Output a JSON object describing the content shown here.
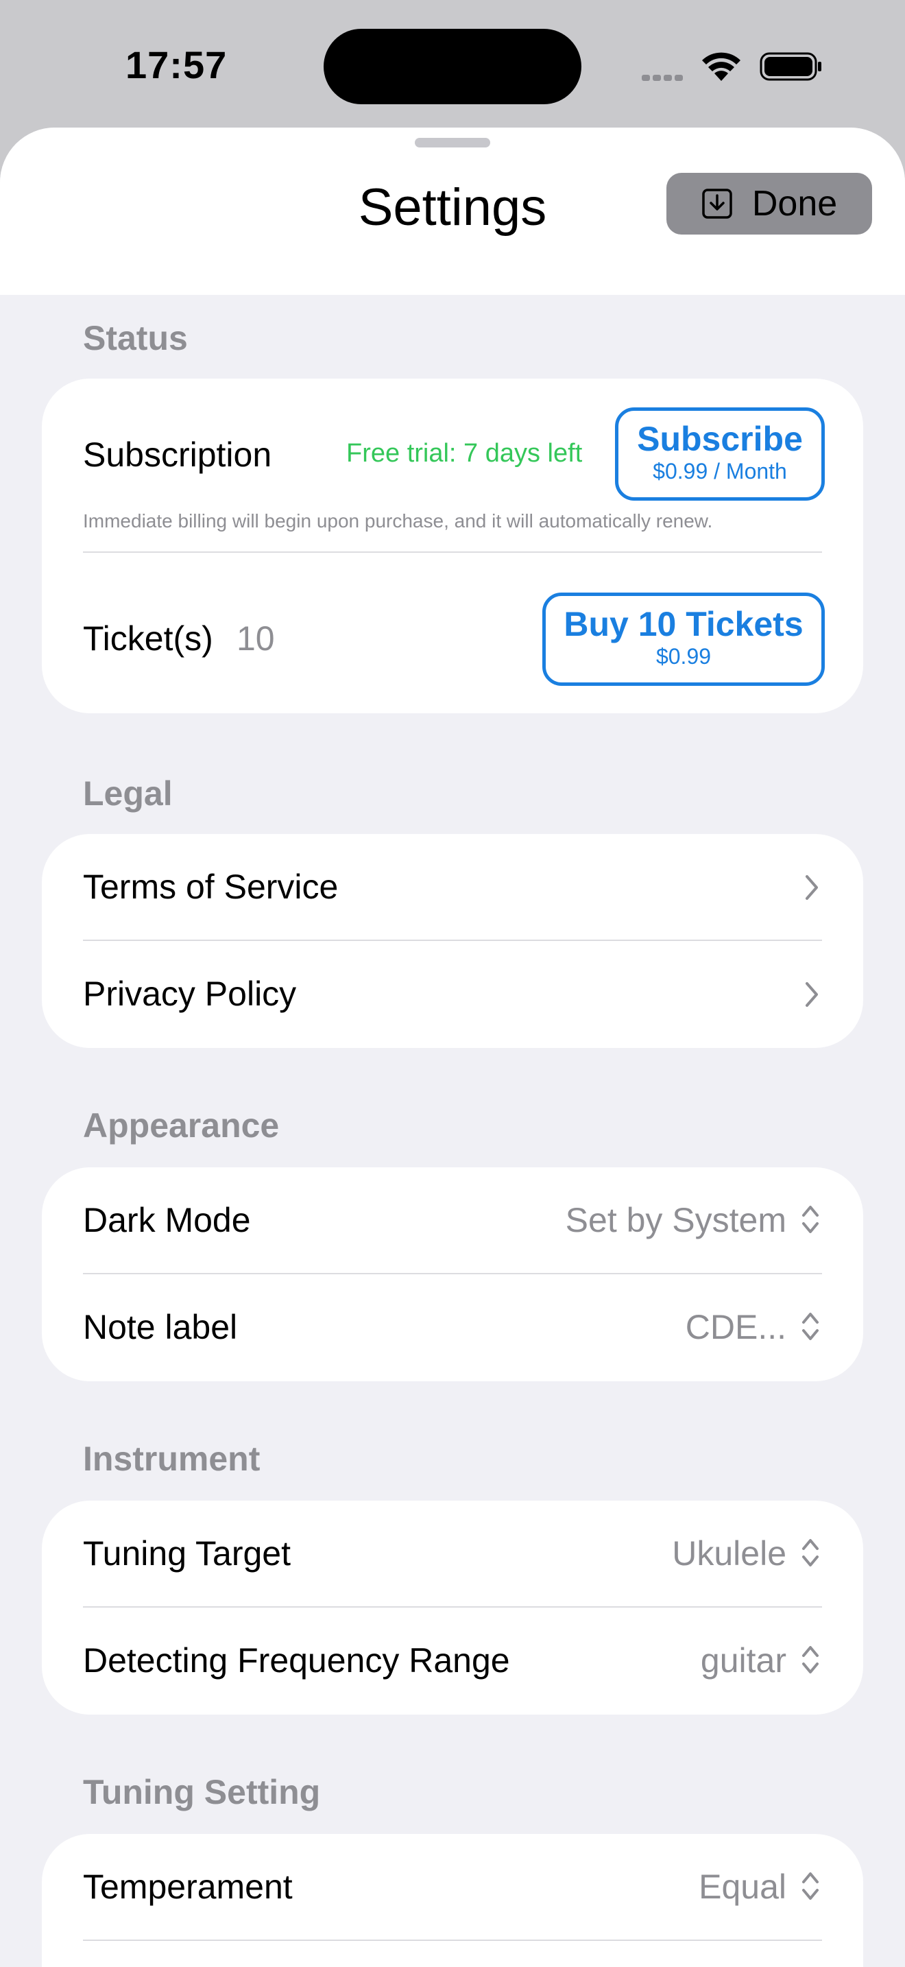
{
  "status_bar": {
    "time": "17:57"
  },
  "sheet": {
    "title": "Settings",
    "done_label": "Done"
  },
  "status": {
    "header": "Status",
    "subscription_label": "Subscription",
    "trial_text": "Free trial: 7 days left",
    "subscribe_label": "Subscribe",
    "subscribe_price": "$0.99 / Month",
    "billing_note": "Immediate billing will begin upon purchase, and it will automatically renew.",
    "tickets_label": "Ticket(s)",
    "tickets_count": "10",
    "buy_label": "Buy 10 Tickets",
    "buy_price": "$0.99"
  },
  "legal": {
    "header": "Legal",
    "terms": "Terms of Service",
    "privacy": "Privacy Policy"
  },
  "appearance": {
    "header": "Appearance",
    "dark_mode_label": "Dark Mode",
    "dark_mode_value": "Set by System",
    "note_label_label": "Note label",
    "note_label_value": "CDE..."
  },
  "instrument": {
    "header": "Instrument",
    "target_label": "Tuning Target",
    "target_value": "Ukulele",
    "range_label": "Detecting Frequency Range",
    "range_value": "guitar"
  },
  "tuning": {
    "header": "Tuning Setting",
    "temperament_label": "Temperament",
    "temperament_value": "Equal"
  },
  "colors": {
    "accent": "#1a7fe0",
    "trial": "#34c759",
    "secondary": "#8e8e93",
    "background": "#f0f0f5"
  }
}
